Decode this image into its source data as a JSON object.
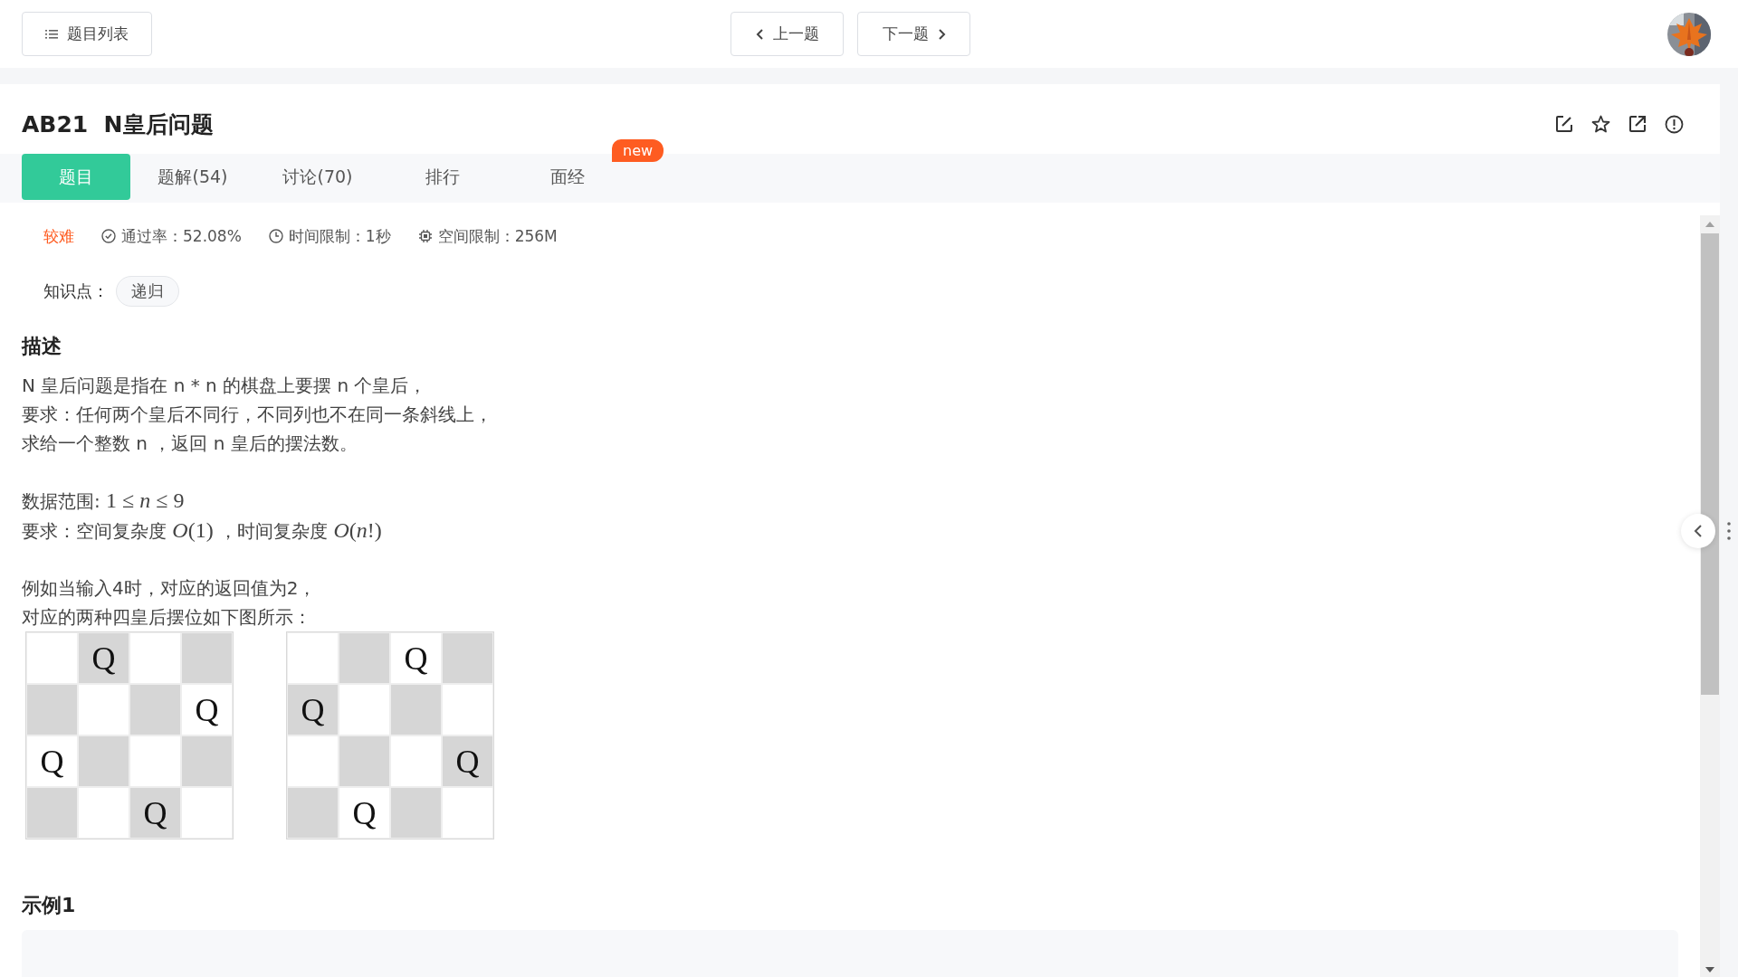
{
  "topbar": {
    "list_button": "题目列表",
    "prev_button": "上一题",
    "next_button": "下一题"
  },
  "problem": {
    "code": "AB21",
    "title": "N皇后问题"
  },
  "tabs": [
    {
      "label": "题目",
      "selected": true
    },
    {
      "label": "题解(54)",
      "selected": false
    },
    {
      "label": "讨论(70)",
      "selected": false
    },
    {
      "label": "排行",
      "selected": false
    },
    {
      "label": "面经",
      "selected": false,
      "badge": "new"
    }
  ],
  "meta": {
    "difficulty": "较难",
    "pass_rate": "通过率：52.08%",
    "time_limit": "时间限制：1秒",
    "memory_limit": "空间限制：256M"
  },
  "knowledge": {
    "label": "知识点：",
    "tags": [
      "递归"
    ]
  },
  "description": {
    "heading": "描述",
    "paragraphs": [
      [
        [
          {
            "kind": "text",
            "text": "N 皇后问题是指在 n * n 的棋盘上要摆 n 个皇后，"
          }
        ],
        [
          {
            "kind": "text",
            "text": "要求：任何两个皇后不同行，不同列也不在同一条斜线上，"
          }
        ],
        [
          {
            "kind": "text",
            "text": "求给一个整数 n ，返回 n 皇后的摆法数。"
          }
        ]
      ],
      [
        [
          {
            "kind": "text",
            "text": "数据范围: "
          },
          {
            "kind": "math",
            "text": "1 ≤ *n* ≤ 9"
          }
        ],
        [
          {
            "kind": "text",
            "text": "要求：空间复杂度 "
          },
          {
            "kind": "math",
            "text": "*O*(1)"
          },
          {
            "kind": "text",
            "text": " ，时间复杂度 "
          },
          {
            "kind": "math",
            "text": "*O*(*n*!)"
          }
        ]
      ],
      [
        [
          {
            "kind": "text",
            "text": "例如当输入4时，对应的返回值为2，"
          }
        ],
        [
          {
            "kind": "text",
            "text": "对应的两种四皇后摆位如下图所示："
          }
        ]
      ]
    ],
    "boards": [
      [
        [
          {
            "shaded": false
          },
          {
            "shaded": true,
            "text": "Q"
          },
          {
            "shaded": false
          },
          {
            "shaded": true
          }
        ],
        [
          {
            "shaded": true
          },
          {
            "shaded": false
          },
          {
            "shaded": true
          },
          {
            "shaded": false,
            "text": "Q"
          }
        ],
        [
          {
            "shaded": false,
            "text": "Q"
          },
          {
            "shaded": true
          },
          {
            "shaded": false
          },
          {
            "shaded": true
          }
        ],
        [
          {
            "shaded": true
          },
          {
            "shaded": false
          },
          {
            "shaded": true,
            "text": "Q"
          },
          {
            "shaded": false
          }
        ]
      ],
      [
        [
          {
            "shaded": false
          },
          {
            "shaded": true
          },
          {
            "shaded": false,
            "text": "Q"
          },
          {
            "shaded": true
          }
        ],
        [
          {
            "shaded": true,
            "text": "Q"
          },
          {
            "shaded": false
          },
          {
            "shaded": true
          },
          {
            "shaded": false
          }
        ],
        [
          {
            "shaded": false
          },
          {
            "shaded": true
          },
          {
            "shaded": false
          },
          {
            "shaded": true,
            "text": "Q"
          }
        ],
        [
          {
            "shaded": true
          },
          {
            "shaded": false,
            "text": "Q"
          },
          {
            "shaded": true
          },
          {
            "shaded": false
          }
        ]
      ]
    ]
  },
  "example": {
    "heading": "示例1"
  }
}
